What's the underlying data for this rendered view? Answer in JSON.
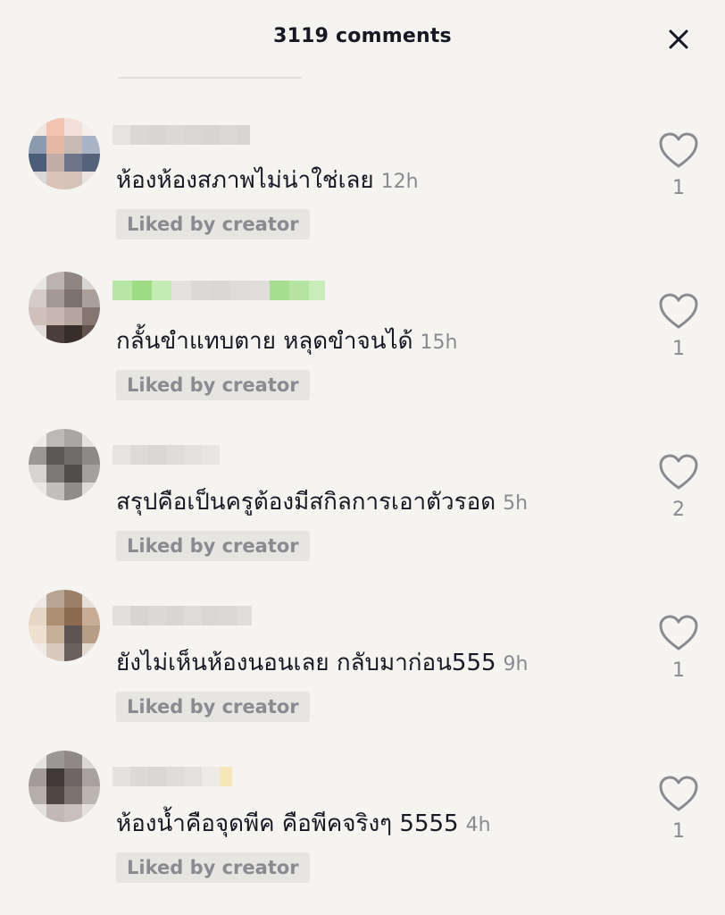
{
  "header": {
    "title": "3119 comments",
    "close_icon": "close-icon"
  },
  "liked_label": "Liked by creator",
  "comments": [
    {
      "text": "ห้องห้องสภาพไม่น่าใช่เลย",
      "time": "12h",
      "likes": "1"
    },
    {
      "text": "กลั้นขำแทบตาย หลุดขำจนได้",
      "time": "15h",
      "likes": "1"
    },
    {
      "text": "สรุปคือเป็นครูต้องมีสกิลการเอาตัวรอด",
      "time": "5h",
      "likes": "2"
    },
    {
      "text": "ยังไม่เห็นห้องนอนเลย กลับมาก่อน555",
      "time": "9h",
      "likes": "1"
    },
    {
      "text": "ห้องน้ำคือจุดพีค คือพีคจริงๆ 5555",
      "time": "4h",
      "likes": "1"
    }
  ],
  "colors": {
    "background": "#f5f4f0",
    "text": "#161823",
    "muted": "#8a8b91",
    "badge_bg": "#e6e5e1"
  }
}
